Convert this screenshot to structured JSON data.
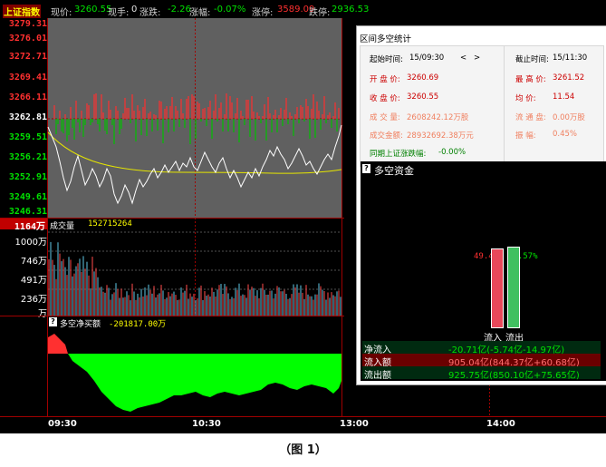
{
  "header": {
    "index_name": "上证指数",
    "price_label": "现价:",
    "price_value": "3260.55",
    "hand_label": "现手:",
    "hand_value": "0",
    "change_label": "涨跌:",
    "change_value": "-2.26",
    "pct_label": "涨幅:",
    "pct_value": "-0.07%",
    "limit_up_label": "涨停:",
    "limit_up_value": "3589.09",
    "limit_down_label": "跌停:",
    "limit_down_value": "2936.53"
  },
  "price_axis": [
    "3279.31",
    "3276.01",
    "3272.71",
    "3269.41",
    "3266.11",
    "3262.81",
    "3259.51",
    "3256.21",
    "3252.91",
    "3249.61",
    "3246.31"
  ],
  "volume": {
    "current_label": "1164万",
    "title": "成交量",
    "value": "152715264",
    "axis": [
      "1000万",
      "746万",
      "491万",
      "236万",
      "万"
    ]
  },
  "net_buy": {
    "title": "多空净买额",
    "value": "-201817.00万",
    "help_icon": "?"
  },
  "time_axis": [
    "09:30",
    "10:30",
    "13:00",
    "14:00"
  ],
  "panel": {
    "title": "区间多空统计",
    "start_label": "起始时间:",
    "start_value": "15/09:30",
    "nav_prev": "<",
    "nav_next": ">",
    "end_label": "截止时间:",
    "end_value": "15/11:30",
    "open_label": "开 盘 价:",
    "open_value": "3260.69",
    "high_label": "最 高 价:",
    "high_value": "3261.52",
    "close_label": "收 盘 价:",
    "close_value": "3260.55",
    "avg_label": "均    价:",
    "avg_value": "11.54",
    "vol_label": "成 交 量:",
    "vol_value": "2608242.12万股",
    "float_label": "流 通 盘:",
    "float_value": "0.00万股",
    "amount_label": "成交金额:",
    "amount_value": "28932692.38万元",
    "amp_label": "振    幅:",
    "amp_value": "0.45%",
    "period_label": "同期上证涨跌幅:",
    "period_value": "-0.00%"
  },
  "fund": {
    "help_icon": "?",
    "title": "多空资金",
    "inflow_pct": "49.43%",
    "outflow_pct": "50.57%",
    "inflow_share": 0.4943,
    "outflow_share": 0.5057,
    "inflow_label": "流入",
    "outflow_label": "流出",
    "rows": [
      {
        "label": "净流入",
        "value": "-20.71亿(-5.74亿-14.97亿)"
      },
      {
        "label": "流入额",
        "value": "905.04亿(844.37亿+60.68亿)"
      },
      {
        "label": "流出额",
        "value": "925.75亿(850.10亿+75.65亿)"
      }
    ]
  },
  "caption": "（图 1）",
  "colors": {
    "up": "#ff3030",
    "down": "#00c000",
    "panel_bg": "#606060",
    "grid": "#a00000",
    "avg_line": "#e6e600"
  }
}
